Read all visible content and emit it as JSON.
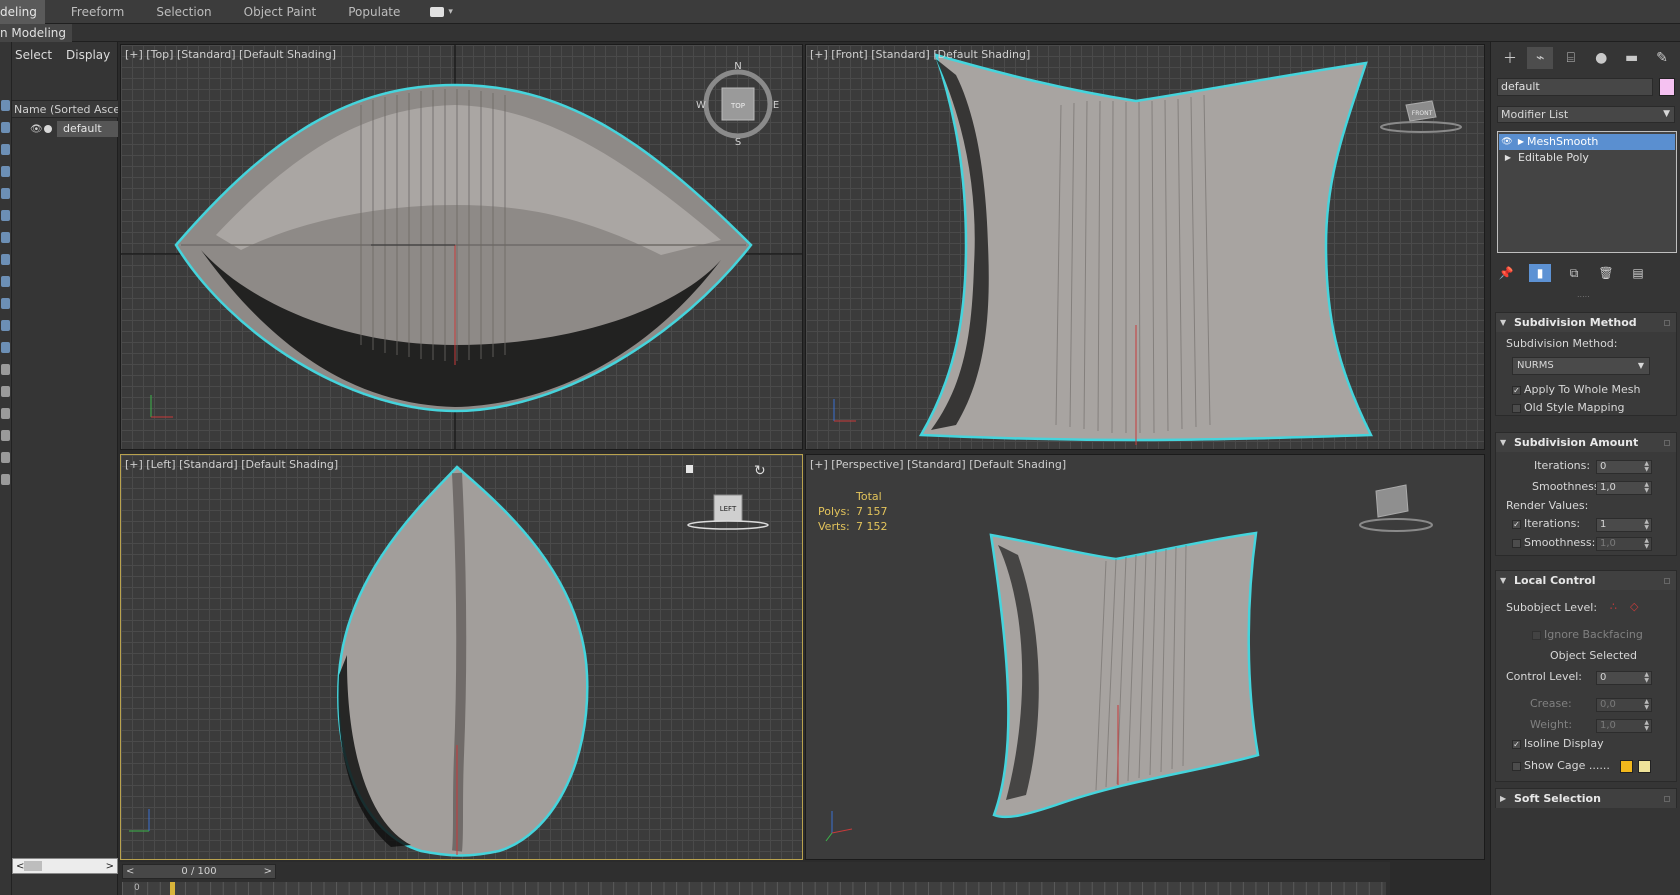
{
  "ribbon": {
    "tabs": [
      "deling",
      "Freeform",
      "Selection",
      "Object Paint",
      "Populate"
    ],
    "sub_label": "n Modeling"
  },
  "scene_explorer": {
    "tabs": [
      "Select",
      "Display"
    ],
    "column_header": "Name (Sorted Ascen",
    "items": [
      {
        "name": "default"
      }
    ]
  },
  "viewports": {
    "top": {
      "label": "[+] [Top] [Standard] [Default Shading]",
      "compass": [
        "N",
        "E",
        "S",
        "W"
      ],
      "cube_label": "TOP"
    },
    "front": {
      "label": "[+] [Front] [Standard] [Default Shading]",
      "cube_label": "FRONT"
    },
    "left": {
      "label": "[+] [Left] [Standard] [Default Shading]",
      "cube_label": "LEFT"
    },
    "perspective": {
      "label": "[+] [Perspective] [Standard] [Default Shading]",
      "stats_header": "Total",
      "stats": [
        {
          "key": "Polys:",
          "value": "7 157"
        },
        {
          "key": "Verts:",
          "value": "7 152"
        }
      ]
    }
  },
  "timeline": {
    "frame": "0 / 100",
    "prev": "<",
    "next": ">",
    "track_start": "0"
  },
  "command_panel": {
    "object_name": "default",
    "object_color": "#f5c1f1",
    "modifier_list_label": "Modifier List",
    "stack": [
      {
        "name": "MeshSmooth",
        "selected": true
      },
      {
        "name": "Editable Poly",
        "selected": false
      }
    ],
    "rollouts": {
      "subdivision_method": {
        "title": "Subdivision Method",
        "method_label": "Subdivision Method:",
        "method_value": "NURMS",
        "apply_whole_mesh": "Apply To Whole Mesh",
        "apply_whole_mesh_checked": true,
        "old_style_mapping": "Old Style Mapping",
        "old_style_mapping_checked": false
      },
      "subdivision_amount": {
        "title": "Subdivision Amount",
        "iterations_label": "Iterations:",
        "iterations_value": "0",
        "smoothness_label": "Smoothness:",
        "smoothness_value": "1,0",
        "render_values_label": "Render Values:",
        "render_iterations_label": "Iterations:",
        "render_iterations_value": "1",
        "render_iterations_checked": true,
        "render_smoothness_label": "Smoothness:",
        "render_smoothness_value": "1,0",
        "render_smoothness_checked": false
      },
      "local_control": {
        "title": "Local Control",
        "subobject_level_label": "Subobject Level:",
        "ignore_backfacing": "Ignore Backfacing",
        "object_selected": "Object Selected",
        "control_level_label": "Control Level:",
        "control_level_value": "0",
        "crease_label": "Crease:",
        "crease_value": "0,0",
        "weight_label": "Weight:",
        "weight_value": "1,0",
        "isoline_display": "Isoline Display",
        "isoline_checked": true,
        "show_cage": "Show Cage ......",
        "show_cage_checked": false,
        "cage_colors": [
          "#f2b81c",
          "#efe39a"
        ]
      },
      "soft_selection": {
        "title": "Soft Selection"
      }
    }
  },
  "colors": {
    "selection_outline": "#45d4dc",
    "stats_text": "#e2c35b",
    "active_viewport_border": "#b9a24e"
  }
}
